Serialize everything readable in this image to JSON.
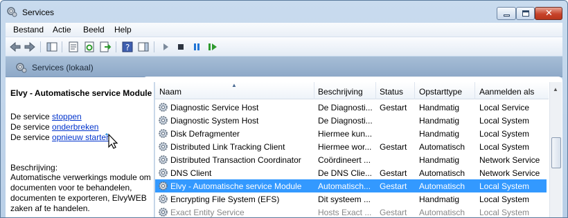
{
  "window": {
    "title": "Services"
  },
  "menu": [
    "Bestand",
    "Actie",
    "Beeld",
    "Help"
  ],
  "toolbar": {
    "icons": [
      "back-icon",
      "forward-icon",
      "show-hide-tree-icon",
      "properties-icon",
      "refresh-icon",
      "export-list-icon",
      "help-icon",
      "show-hide-action-pane-icon",
      "start-service-icon",
      "stop-service-icon",
      "pause-service-icon",
      "restart-service-icon"
    ]
  },
  "band": {
    "title": "Services (lokaal)"
  },
  "details": {
    "service_name": "Elvy - Automatische service Module",
    "actions": [
      {
        "prefix": "De service ",
        "link": "stoppen"
      },
      {
        "prefix": "De service ",
        "link": "onderbreken"
      },
      {
        "prefix": "De service ",
        "link": "opnieuw starten"
      }
    ],
    "description_label": "Beschrijving:",
    "description": "Automatische verwerkings module om documenten voor te behandelen, documenten te exporteren, ElvyWEB zaken af te handelen."
  },
  "table": {
    "columns": [
      "Naam",
      "Beschrijving",
      "Status",
      "Opstarttype",
      "Aanmelden als"
    ],
    "rows": [
      [
        "Diagnostic Service Host",
        "De Diagnosti...",
        "Gestart",
        "Handmatig",
        "Local Service"
      ],
      [
        "Diagnostic System Host",
        "De Diagnosti...",
        "",
        "Handmatig",
        "Local System"
      ],
      [
        "Disk Defragmenter",
        "Hiermee kun...",
        "",
        "Handmatig",
        "Local System"
      ],
      [
        "Distributed Link Tracking Client",
        "Hiermee wor...",
        "Gestart",
        "Automatisch",
        "Local System"
      ],
      [
        "Distributed Transaction Coordinator",
        "Coördineert ...",
        "",
        "Handmatig",
        "Network Service"
      ],
      [
        "DNS Client",
        "De DNS Clie...",
        "Gestart",
        "Automatisch",
        "Network Service"
      ],
      [
        "Elvy - Automatische service Module",
        "Automatisch...",
        "Gestart",
        "Automatisch",
        "Local System"
      ],
      [
        "Encrypting File System (EFS)",
        "Dit systeem ...",
        "",
        "Handmatig",
        "Local System"
      ],
      [
        "Exact Entity Service",
        "Hosts Exact ...",
        "Gestart",
        "Automatisch",
        "Local System"
      ]
    ],
    "selected_index": 6
  },
  "colors": {
    "selection": "#3399ff",
    "link": "#0033cc"
  }
}
